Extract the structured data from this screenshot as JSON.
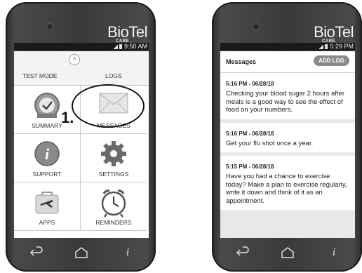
{
  "brand": {
    "name": "BioTel",
    "sub": "CARE"
  },
  "left_phone": {
    "time": "9:50 AM",
    "tabs": {
      "test_mode": "TEST MODE",
      "logs": "LOGS"
    },
    "tiles": [
      {
        "label": "SUMMARY",
        "icon": "checkmark-gauge-icon"
      },
      {
        "label": "MESSAGES",
        "icon": "envelope-icon"
      },
      {
        "label": "SUPPORT",
        "icon": "info-icon"
      },
      {
        "label": "SETTINGS",
        "icon": "gear-icon"
      },
      {
        "label": "APPS",
        "icon": "apps-bag-icon"
      },
      {
        "label": "REMINDERS",
        "icon": "alarm-clock-icon"
      }
    ],
    "callout_number": "1."
  },
  "right_phone": {
    "time": "5:29 PM",
    "header_title": "Messages",
    "add_log_label": "ADD LOG",
    "messages": [
      {
        "time": "5:16 PM - 06/28/18",
        "text": "Checking your blood sugar 2 hours after meals is a good way to see the effect of food on your numbers."
      },
      {
        "time": "5:16 PM - 06/28/18",
        "text": "Get your flu shot once a year."
      },
      {
        "time": "5:15 PM - 06/28/18",
        "text": "Have you had a chance to exercise today? Make a plan to exercise regularly, write it down and think of it as an appointment."
      }
    ]
  },
  "nav": {
    "info_glyph": "i"
  }
}
